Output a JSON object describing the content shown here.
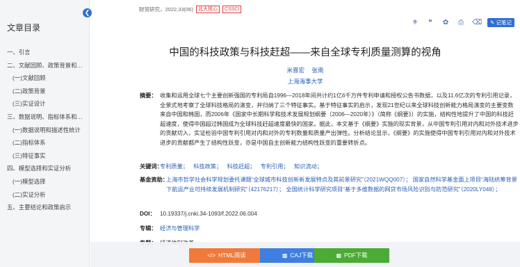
{
  "sidebar": {
    "title": "文章目录",
    "items": [
      {
        "label": "一、引言",
        "level": 1
      },
      {
        "label": "二、文献回顾、政策背景和实...",
        "level": 1
      },
      {
        "label": "(一)文献回顾",
        "level": 2
      },
      {
        "label": "(二)政策背景",
        "level": 2
      },
      {
        "label": "(三)实证设计",
        "level": 2
      },
      {
        "label": "三、数据说明、指标体系和特...",
        "level": 1
      },
      {
        "label": "(一)数据说明和描述性统计",
        "level": 2
      },
      {
        "label": "(二)指标体系",
        "level": 2
      },
      {
        "label": "(三)特征事实",
        "level": 2
      },
      {
        "label": "四、模型选择和实证分析",
        "level": 1
      },
      {
        "label": "(一)模型选择",
        "level": 2
      },
      {
        "label": "(二)实证分析",
        "level": 2
      },
      {
        "label": "五、主要结论和政策启示",
        "level": 1
      }
    ]
  },
  "header": {
    "source": "财贸研究，2022,33(06)",
    "badges": [
      "北大核心",
      "CSSCI"
    ],
    "note_button": "记笔记"
  },
  "toolbar_icons": [
    "share-icon",
    "quote-icon",
    "favorite-icon",
    "print-icon",
    "translate-icon"
  ],
  "article": {
    "title": "中国的科技政策与科技赶超——来自全球专利质量测算的视角",
    "authors": [
      "米晋宏",
      "张南"
    ],
    "affiliation": "上海海事大学",
    "abstract_label": "摘要：",
    "abstract": "收集和运用全球七个主要创新强国的专利局自1996—2018年间共计约1亿6千万件专利申请和授权公告书数据，以及11.6亿次的专利引用记录，全景式地考察了全球科技格局的演变，并归纳了三个特征事实。基于特征事实的启示，发现21世纪以来全球科技创新能力格局演变的主要变数来自中国和韩国，而2006年《国家中长期科学和技术发展规划纲要（2006—2020年）》（简称《纲要》）的实施，结构性地提升了中国的科技赶超速度，使得中国超过韩国成为全球科技赶超速度最快的国家。据此，本文基于《纲要》实施的现实背景，从中国专利引用对内和对外技术进步的贡献切入，实证检验中国专利引用对内和对外的专利数量和质量产出弹性。分析结论显示，《纲要》的实施使得中国专利引用对内和对外技术进步的贡献都产生了结构性跃变，亦是中国自主创新能力结构性跃变的重要转折点。",
    "keywords_label": "关键词：",
    "keywords": [
      "专利质量；",
      "科技政策；",
      "科技赶超；",
      "专利引用；",
      "知识流动；"
    ],
    "funds_label": "基金资助：",
    "funds": "上海市哲学社会科学规划委托课题“全球城市科技创新新发展特点及其前景研究”（2021WQQ007）；  国家自然科学基金面上项目“海陆统筹背景下航运产业可持续发展机制研究”（42176217）；  全国统计科学研究项目“基于多维数据的网贷市场风险识别与防范研究”（2020LY048）；",
    "doi_label": "DOI：",
    "doi": "10.19337/j.cnki.34-1093/f.2022.06.004",
    "topic_label": "专辑：",
    "topic": "经济与管理科学",
    "category_label": "专题：",
    "category": "经济体制改革"
  },
  "bottom_bar": {
    "html_button": "HTML阅读",
    "caj_button": "CAJ下载",
    "pdf_button": "PDF下载"
  },
  "colors": {
    "accent": "#2f6fd1",
    "link": "#2b5fb3",
    "html_btn": "#f07a3c",
    "caj_btn": "#3f7fe0",
    "pdf_btn": "#4bab35",
    "badge": "#e03b3b"
  }
}
